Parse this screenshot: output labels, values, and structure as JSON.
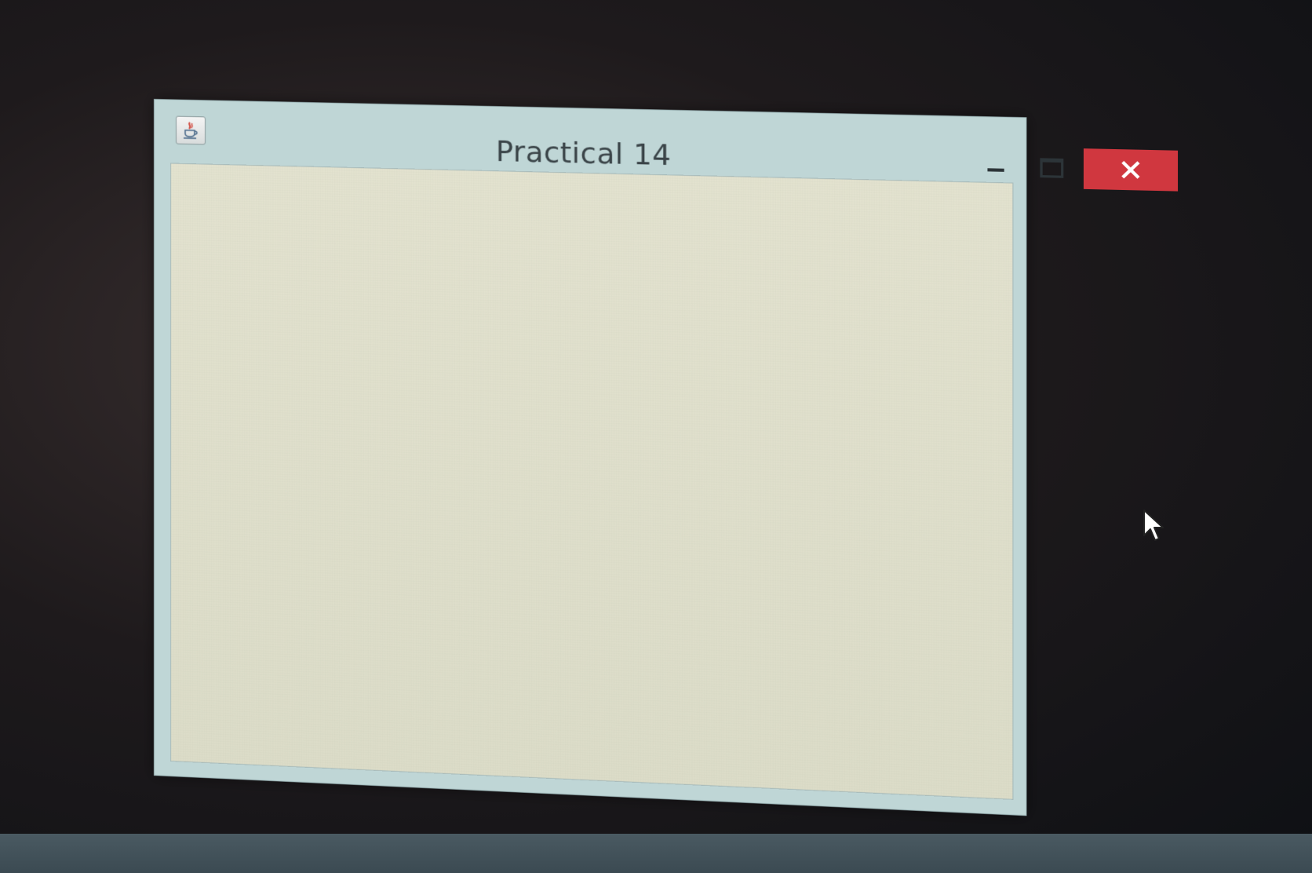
{
  "window": {
    "title": "Practical 14",
    "app_icon": "java-coffee-icon",
    "controls": {
      "minimize": "minimize-icon",
      "maximize": "maximize-icon",
      "close": "close-icon"
    }
  },
  "colors": {
    "close_button": "#d0373f",
    "frame": "#bfd6d6",
    "client_area": "#e0dfcc"
  },
  "cursor": "arrow-cursor-icon"
}
